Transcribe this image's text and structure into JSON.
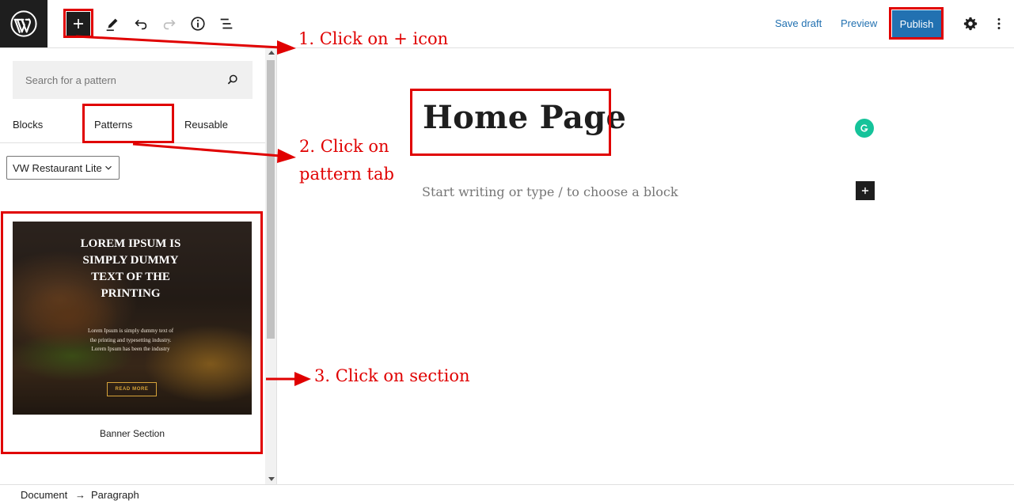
{
  "toolbar": {
    "save_draft": "Save draft",
    "preview": "Preview",
    "publish": "Publish"
  },
  "inserter": {
    "search_placeholder": "Search for a pattern",
    "tabs": [
      "Blocks",
      "Patterns",
      "Reusable"
    ],
    "category": "VW Restaurant Lite",
    "pattern": {
      "title": "LOREM IPSUM IS SIMPLY DUMMY TEXT OF THE PRINTING",
      "text": "Lorem Ipsum is simply dummy text of the printing and typesetting industry. Lorem Ipsum has been the industry",
      "button": "READ MORE",
      "label": "Banner Section"
    }
  },
  "editor": {
    "title": "Home Page",
    "placeholder": "Start writing or type / to choose a block"
  },
  "annotations": {
    "step1": "1. Click on + icon",
    "step2_line1": "2. Click on",
    "step2_line2": "pattern tab",
    "step3": "3. Click on section"
  },
  "breadcrumb": {
    "item1": "Document",
    "separator": "→",
    "item2": "Paragraph"
  },
  "colors": {
    "accent": "#2271b1",
    "annotation_red": "#e00000",
    "dark": "#1e1e1e",
    "grammarly": "#15c39a"
  }
}
